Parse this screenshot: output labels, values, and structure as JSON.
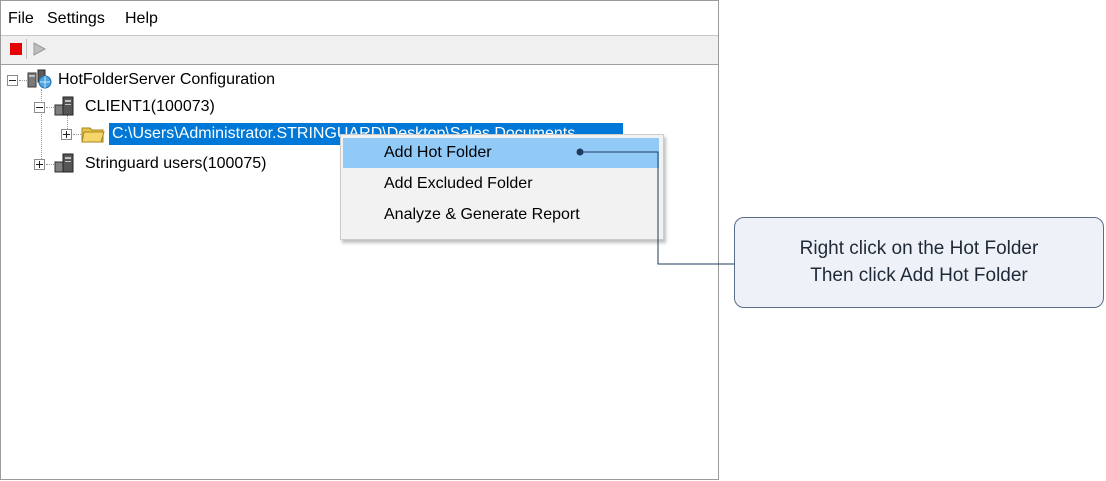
{
  "menubar": {
    "items": [
      "File",
      "Settings",
      "Help"
    ]
  },
  "toolbar": {
    "buttons": [
      {
        "icon": "stop-icon",
        "color": "#e60000"
      },
      {
        "icon": "play-icon"
      }
    ]
  },
  "tree": {
    "root": {
      "label": "HotFolderServer Configuration",
      "icon": "server-network-icon"
    },
    "client1": {
      "label": "CLIENT1(100073)",
      "icon": "computer-icon"
    },
    "folder": {
      "label": "C:\\Users\\Administrator.STRINGUARD\\Desktop\\Sales Documents",
      "icon": "folder-icon"
    },
    "users": {
      "label": "Stringuard users(100075)",
      "icon": "computer-icon"
    }
  },
  "context_menu": {
    "items": [
      "Add Hot Folder",
      "Add Excluded Folder",
      "Analyze & Generate Report"
    ],
    "highlighted": "Add Hot Folder"
  },
  "callout": {
    "line1": "Right click on the Hot Folder",
    "line2": "Then click Add Hot Folder"
  },
  "colors": {
    "selection": "#0078d7",
    "menu_hover": "#91c9f7",
    "callout_border": "#5a6e8a",
    "connector": "#1f3a5f"
  }
}
